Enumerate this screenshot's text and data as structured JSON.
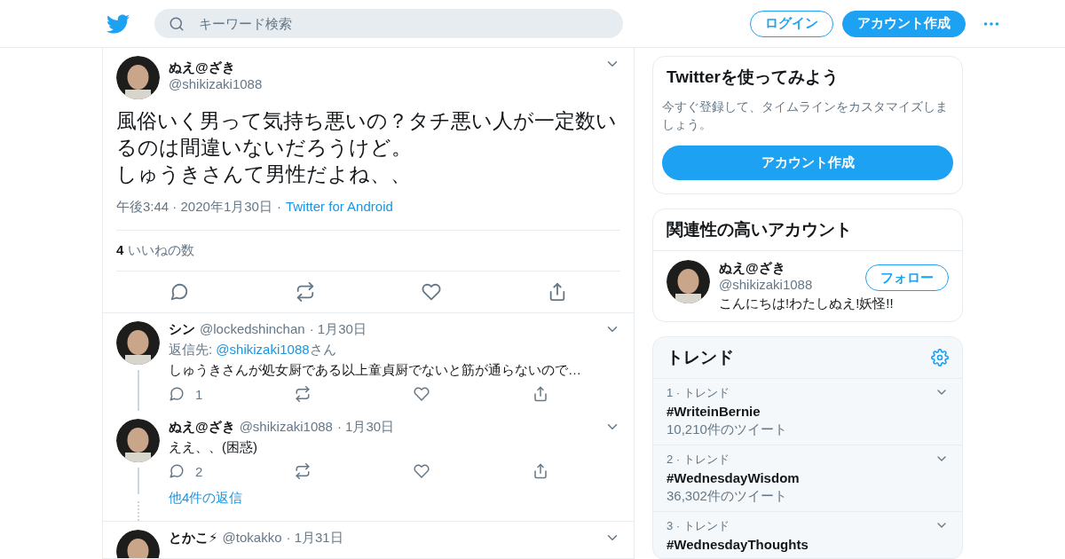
{
  "header": {
    "search": {
      "placeholder": "キーワード検索"
    },
    "login": "ログイン",
    "signup": "アカウント作成"
  },
  "tweet": {
    "name": "ぬえ@ざき",
    "handle": "@shikizaki1088",
    "lines": [
      "風俗いく男って気持ち悪いの？タチ悪い人が一定数い",
      "るのは間違いないだろうけど。",
      "しゅうきさんて男性だよね、、"
    ],
    "time": "午後3:44 · 2020年1月30日",
    "sep": "·",
    "source": "Twitter for Android",
    "likes_count": "4",
    "likes_label": "いいねの数"
  },
  "replies": [
    {
      "name": "シン",
      "handle": "@lockedshinchan",
      "date": "· 1月30日",
      "reply_to_label": "返信先:",
      "reply_to": "@shikizaki1088",
      "reply_to_suffix": "さん",
      "text": "しゅうきさんが処女厨である以上童貞厨でないと筋が通らないので…",
      "reply_count": "1",
      "thread_line": true
    },
    {
      "name": "ぬえ@ざき",
      "handle": "@shikizaki1088",
      "date": "· 1月30日",
      "text": "ええ、、(困惑)",
      "reply_count": "2",
      "thread_line": true,
      "more": "他4件の返信"
    },
    {
      "name": "とかこ⚡",
      "handle": "@tokakko",
      "date": "· 1月31日",
      "thread_line": false
    }
  ],
  "sidebar": {
    "signup_card": {
      "title": "Twitterを使ってみよう",
      "text": "今すぐ登録して、タイムラインをカスタマイズしましょう。",
      "button": "アカウント作成"
    },
    "related": {
      "title": "関連性の高いアカウント",
      "name": "ぬえ@ざき",
      "handle": "@shikizaki1088",
      "bio": "こんにちは!わたしぬえ!妖怪!!",
      "follow": "フォロー"
    },
    "trends": {
      "title": "トレンド",
      "items": [
        {
          "meta": "1 · トレンド",
          "tag": "#WriteinBernie",
          "count": "10,210件のツイート"
        },
        {
          "meta": "2 · トレンド",
          "tag": "#WednesdayWisdom",
          "count": "36,302件のツイート"
        },
        {
          "meta": "3 · トレンド",
          "tag": "#WednesdayThoughts"
        }
      ]
    }
  }
}
